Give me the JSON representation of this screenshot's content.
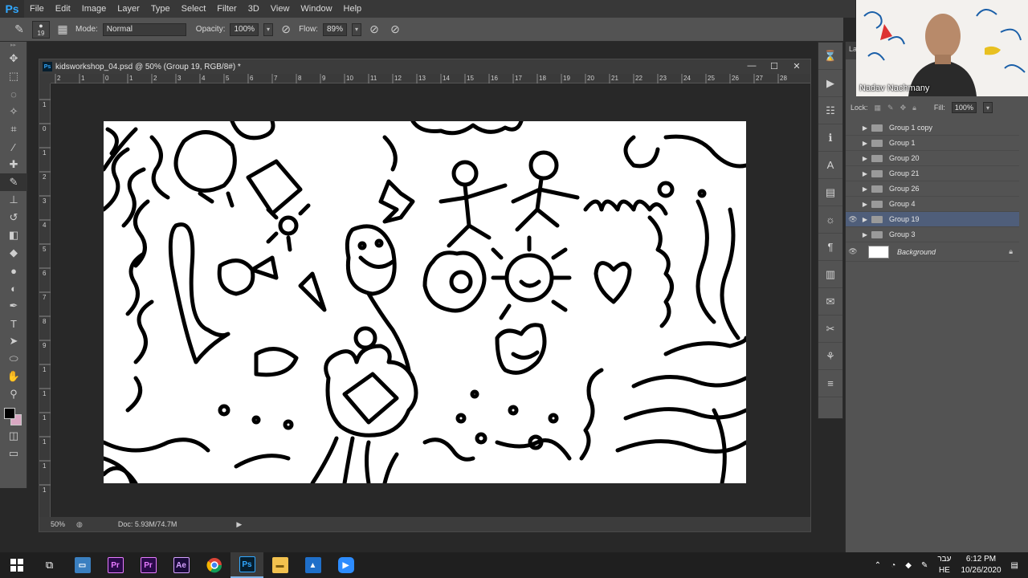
{
  "app": {
    "logo": "Ps"
  },
  "menu": [
    "File",
    "Edit",
    "Image",
    "Layer",
    "Type",
    "Select",
    "Filter",
    "3D",
    "View",
    "Window",
    "Help"
  ],
  "options": {
    "brush_size": "19",
    "mode_label": "Mode:",
    "mode_value": "Normal",
    "opacity_label": "Opacity:",
    "opacity_value": "100%",
    "flow_label": "Flow:",
    "flow_value": "89%"
  },
  "document": {
    "title": "kidsworkshop_04.psd @ 50% (Group 19, RGB/8#) *",
    "zoom": "50%",
    "doc_size": "Doc: 5.93M/74.7M",
    "ruler_top": [
      "2",
      "1",
      "0",
      "1",
      "2",
      "3",
      "4",
      "5",
      "6",
      "7",
      "8",
      "9",
      "10",
      "11",
      "12",
      "13",
      "14",
      "15",
      "16",
      "17",
      "18",
      "19",
      "20",
      "21",
      "22",
      "23",
      "24",
      "25",
      "26",
      "27",
      "28"
    ],
    "ruler_left": [
      "1",
      "0",
      "1",
      "2",
      "3",
      "4",
      "5",
      "6",
      "7",
      "8",
      "9",
      "1",
      "1",
      "1",
      "1",
      "1",
      "1"
    ]
  },
  "layers_panel": {
    "tab": "La",
    "lock_label": "Lock:",
    "fill_label": "Fill:",
    "fill_value": "100%",
    "layers": [
      {
        "name": "Group 1 copy",
        "visible": false,
        "selected": false
      },
      {
        "name": "Group 1",
        "visible": false,
        "selected": false
      },
      {
        "name": "Group 20",
        "visible": false,
        "selected": false
      },
      {
        "name": "Group 21",
        "visible": false,
        "selected": false
      },
      {
        "name": "Group 26",
        "visible": false,
        "selected": false
      },
      {
        "name": "Group 4",
        "visible": false,
        "selected": false
      },
      {
        "name": "Group 19",
        "visible": true,
        "selected": true
      },
      {
        "name": "Group 3",
        "visible": false,
        "selected": false
      }
    ],
    "background_layer": "Background"
  },
  "webcam": {
    "name": "Nadav Nachmany"
  },
  "taskbar": {
    "apps": [
      {
        "name": "Pr",
        "color": "#2a0a4a",
        "fg": "#e77bff"
      },
      {
        "name": "Pr",
        "color": "#2a0a4a",
        "fg": "#e77bff"
      },
      {
        "name": "Ae",
        "color": "#1a0a3a",
        "fg": "#d5a0ff"
      },
      {
        "name": "Ps",
        "color": "#061e2e",
        "fg": "#31a8ff"
      }
    ],
    "lang": "עבר",
    "lang_code": "HE",
    "time": "6:12 PM",
    "date": "10/26/2020"
  }
}
